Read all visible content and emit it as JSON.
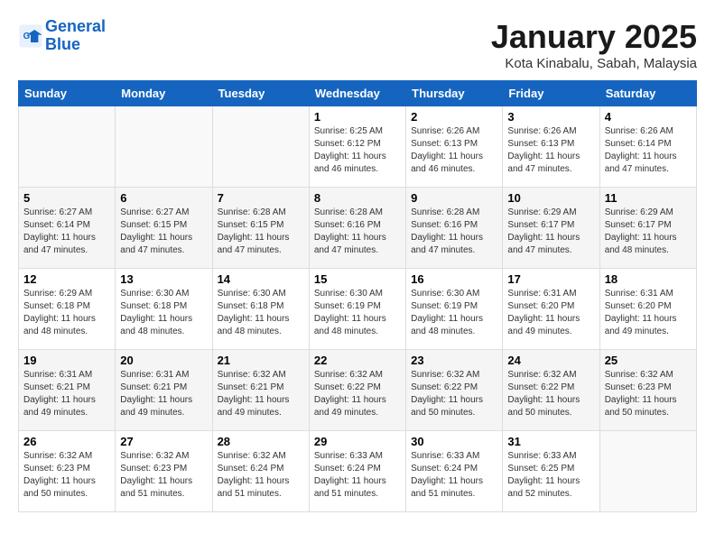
{
  "header": {
    "logo_line1": "General",
    "logo_line2": "Blue",
    "month": "January 2025",
    "location": "Kota Kinabalu, Sabah, Malaysia"
  },
  "days_of_week": [
    "Sunday",
    "Monday",
    "Tuesday",
    "Wednesday",
    "Thursday",
    "Friday",
    "Saturday"
  ],
  "weeks": [
    [
      {
        "day": "",
        "info": ""
      },
      {
        "day": "",
        "info": ""
      },
      {
        "day": "",
        "info": ""
      },
      {
        "day": "1",
        "info": "Sunrise: 6:25 AM\nSunset: 6:12 PM\nDaylight: 11 hours and 46 minutes."
      },
      {
        "day": "2",
        "info": "Sunrise: 6:26 AM\nSunset: 6:13 PM\nDaylight: 11 hours and 46 minutes."
      },
      {
        "day": "3",
        "info": "Sunrise: 6:26 AM\nSunset: 6:13 PM\nDaylight: 11 hours and 47 minutes."
      },
      {
        "day": "4",
        "info": "Sunrise: 6:26 AM\nSunset: 6:14 PM\nDaylight: 11 hours and 47 minutes."
      }
    ],
    [
      {
        "day": "5",
        "info": "Sunrise: 6:27 AM\nSunset: 6:14 PM\nDaylight: 11 hours and 47 minutes."
      },
      {
        "day": "6",
        "info": "Sunrise: 6:27 AM\nSunset: 6:15 PM\nDaylight: 11 hours and 47 minutes."
      },
      {
        "day": "7",
        "info": "Sunrise: 6:28 AM\nSunset: 6:15 PM\nDaylight: 11 hours and 47 minutes."
      },
      {
        "day": "8",
        "info": "Sunrise: 6:28 AM\nSunset: 6:16 PM\nDaylight: 11 hours and 47 minutes."
      },
      {
        "day": "9",
        "info": "Sunrise: 6:28 AM\nSunset: 6:16 PM\nDaylight: 11 hours and 47 minutes."
      },
      {
        "day": "10",
        "info": "Sunrise: 6:29 AM\nSunset: 6:17 PM\nDaylight: 11 hours and 47 minutes."
      },
      {
        "day": "11",
        "info": "Sunrise: 6:29 AM\nSunset: 6:17 PM\nDaylight: 11 hours and 48 minutes."
      }
    ],
    [
      {
        "day": "12",
        "info": "Sunrise: 6:29 AM\nSunset: 6:18 PM\nDaylight: 11 hours and 48 minutes."
      },
      {
        "day": "13",
        "info": "Sunrise: 6:30 AM\nSunset: 6:18 PM\nDaylight: 11 hours and 48 minutes."
      },
      {
        "day": "14",
        "info": "Sunrise: 6:30 AM\nSunset: 6:18 PM\nDaylight: 11 hours and 48 minutes."
      },
      {
        "day": "15",
        "info": "Sunrise: 6:30 AM\nSunset: 6:19 PM\nDaylight: 11 hours and 48 minutes."
      },
      {
        "day": "16",
        "info": "Sunrise: 6:30 AM\nSunset: 6:19 PM\nDaylight: 11 hours and 48 minutes."
      },
      {
        "day": "17",
        "info": "Sunrise: 6:31 AM\nSunset: 6:20 PM\nDaylight: 11 hours and 49 minutes."
      },
      {
        "day": "18",
        "info": "Sunrise: 6:31 AM\nSunset: 6:20 PM\nDaylight: 11 hours and 49 minutes."
      }
    ],
    [
      {
        "day": "19",
        "info": "Sunrise: 6:31 AM\nSunset: 6:21 PM\nDaylight: 11 hours and 49 minutes."
      },
      {
        "day": "20",
        "info": "Sunrise: 6:31 AM\nSunset: 6:21 PM\nDaylight: 11 hours and 49 minutes."
      },
      {
        "day": "21",
        "info": "Sunrise: 6:32 AM\nSunset: 6:21 PM\nDaylight: 11 hours and 49 minutes."
      },
      {
        "day": "22",
        "info": "Sunrise: 6:32 AM\nSunset: 6:22 PM\nDaylight: 11 hours and 49 minutes."
      },
      {
        "day": "23",
        "info": "Sunrise: 6:32 AM\nSunset: 6:22 PM\nDaylight: 11 hours and 50 minutes."
      },
      {
        "day": "24",
        "info": "Sunrise: 6:32 AM\nSunset: 6:22 PM\nDaylight: 11 hours and 50 minutes."
      },
      {
        "day": "25",
        "info": "Sunrise: 6:32 AM\nSunset: 6:23 PM\nDaylight: 11 hours and 50 minutes."
      }
    ],
    [
      {
        "day": "26",
        "info": "Sunrise: 6:32 AM\nSunset: 6:23 PM\nDaylight: 11 hours and 50 minutes."
      },
      {
        "day": "27",
        "info": "Sunrise: 6:32 AM\nSunset: 6:23 PM\nDaylight: 11 hours and 51 minutes."
      },
      {
        "day": "28",
        "info": "Sunrise: 6:32 AM\nSunset: 6:24 PM\nDaylight: 11 hours and 51 minutes."
      },
      {
        "day": "29",
        "info": "Sunrise: 6:33 AM\nSunset: 6:24 PM\nDaylight: 11 hours and 51 minutes."
      },
      {
        "day": "30",
        "info": "Sunrise: 6:33 AM\nSunset: 6:24 PM\nDaylight: 11 hours and 51 minutes."
      },
      {
        "day": "31",
        "info": "Sunrise: 6:33 AM\nSunset: 6:25 PM\nDaylight: 11 hours and 52 minutes."
      },
      {
        "day": "",
        "info": ""
      }
    ]
  ]
}
